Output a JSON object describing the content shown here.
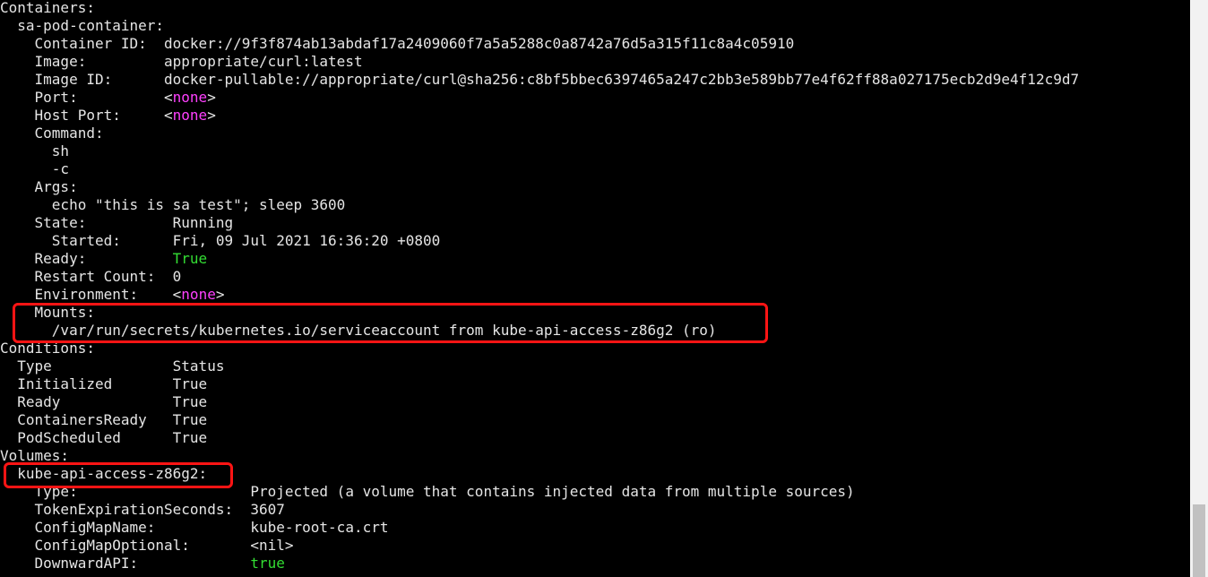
{
  "terminal": {
    "lines": [
      [
        {
          "t": "Containers:",
          "c": ""
        }
      ],
      [
        {
          "t": "  sa-pod-container:",
          "c": ""
        }
      ],
      [
        {
          "t": "    Container ID:  docker://9f3f874ab13abdaf17a2409060f7a5a5288c0a8742a76d5a315f11c8a4c05910",
          "c": ""
        }
      ],
      [
        {
          "t": "    Image:         appropriate/curl:latest",
          "c": ""
        }
      ],
      [
        {
          "t": "    Image ID:      docker-pullable://appropriate/curl@sha256:c8bf5bbec6397465a247c2bb3e589bb77e4f62ff88a027175ecb2d9e4f12c9d7",
          "c": ""
        }
      ],
      [
        {
          "t": "    Port:          <",
          "c": ""
        },
        {
          "t": "none",
          "c": "none"
        },
        {
          "t": ">",
          "c": ""
        }
      ],
      [
        {
          "t": "    Host Port:     <",
          "c": ""
        },
        {
          "t": "none",
          "c": "none"
        },
        {
          "t": ">",
          "c": ""
        }
      ],
      [
        {
          "t": "    Command:",
          "c": ""
        }
      ],
      [
        {
          "t": "      sh",
          "c": ""
        }
      ],
      [
        {
          "t": "      -c",
          "c": ""
        }
      ],
      [
        {
          "t": "    Args:",
          "c": ""
        }
      ],
      [
        {
          "t": "      echo \"this is sa test\"; sleep 3600",
          "c": ""
        }
      ],
      [
        {
          "t": "    State:          Running",
          "c": ""
        }
      ],
      [
        {
          "t": "      Started:      Fri, 09 Jul 2021 16:36:20 +0800",
          "c": ""
        }
      ],
      [
        {
          "t": "    Ready:          ",
          "c": ""
        },
        {
          "t": "True",
          "c": "true"
        }
      ],
      [
        {
          "t": "    Restart Count:  0",
          "c": ""
        }
      ],
      [
        {
          "t": "    Environment:    <",
          "c": ""
        },
        {
          "t": "none",
          "c": "none"
        },
        {
          "t": ">",
          "c": ""
        }
      ],
      [
        {
          "t": "    Mounts:",
          "c": ""
        }
      ],
      [
        {
          "t": "      /var/run/secrets/kubernetes.io/serviceaccount from kube-api-access-z86g2 (ro)",
          "c": ""
        }
      ],
      [
        {
          "t": "Conditions:",
          "c": ""
        }
      ],
      [
        {
          "t": "  Type              Status",
          "c": ""
        }
      ],
      [
        {
          "t": "  Initialized       True",
          "c": ""
        }
      ],
      [
        {
          "t": "  Ready             True",
          "c": ""
        }
      ],
      [
        {
          "t": "  ContainersReady   True",
          "c": ""
        }
      ],
      [
        {
          "t": "  PodScheduled      True",
          "c": ""
        }
      ],
      [
        {
          "t": "Volumes:",
          "c": ""
        }
      ],
      [
        {
          "t": "  kube-api-access-z86g2:",
          "c": ""
        }
      ],
      [
        {
          "t": "    Type:                    Projected (a volume that contains injected data from multiple sources)",
          "c": ""
        }
      ],
      [
        {
          "t": "    TokenExpirationSeconds:  3607",
          "c": ""
        }
      ],
      [
        {
          "t": "    ConfigMapName:           kube-root-ca.crt",
          "c": ""
        }
      ],
      [
        {
          "t": "    ConfigMapOptional:       <nil>",
          "c": ""
        }
      ],
      [
        {
          "t": "    DownwardAPI:             ",
          "c": ""
        },
        {
          "t": "true",
          "c": "true"
        }
      ]
    ]
  },
  "colors": {
    "background": "#000000",
    "foreground": "#e5e5e5",
    "none_value": "#ff40ff",
    "true_value": "#33dd33",
    "annotation_box": "#ff1414"
  }
}
